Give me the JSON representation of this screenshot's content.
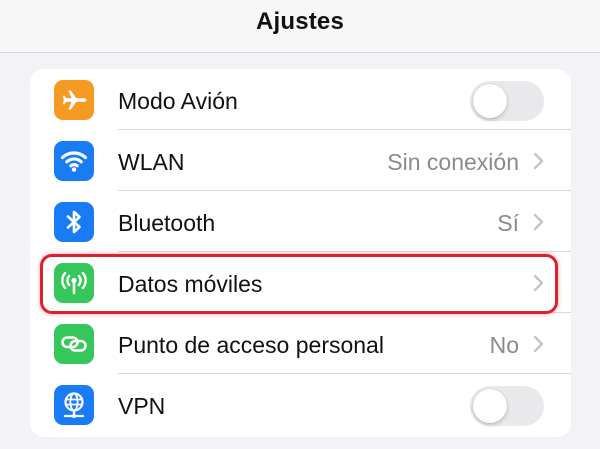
{
  "nav": {
    "title": "Ajustes"
  },
  "colors": {
    "airplane_icon_bg": "#f59a23",
    "wlan_icon_bg": "#1a7cf5",
    "bluetooth_icon_bg": "#1a7cf5",
    "mobile_data_icon_bg": "#35c759",
    "hotspot_icon_bg": "#35c759",
    "vpn_icon_bg": "#1a7cf5",
    "highlight": "#d9212f"
  },
  "rows": [
    {
      "label": "Modo Avión",
      "icon": "airplane-icon",
      "control": "toggle",
      "toggle_on": false
    },
    {
      "label": "WLAN",
      "icon": "wifi-icon",
      "value": "Sin conexión",
      "control": "chevron"
    },
    {
      "label": "Bluetooth",
      "icon": "bluetooth-icon",
      "value": "Sí",
      "control": "chevron"
    },
    {
      "label": "Datos móviles",
      "icon": "antenna-icon",
      "control": "chevron",
      "highlighted": true
    },
    {
      "label": "Punto de acceso personal",
      "icon": "hotspot-link-icon",
      "value": "No",
      "control": "chevron"
    },
    {
      "label": "VPN",
      "icon": "globe-network-icon",
      "control": "toggle",
      "toggle_on": false
    }
  ]
}
